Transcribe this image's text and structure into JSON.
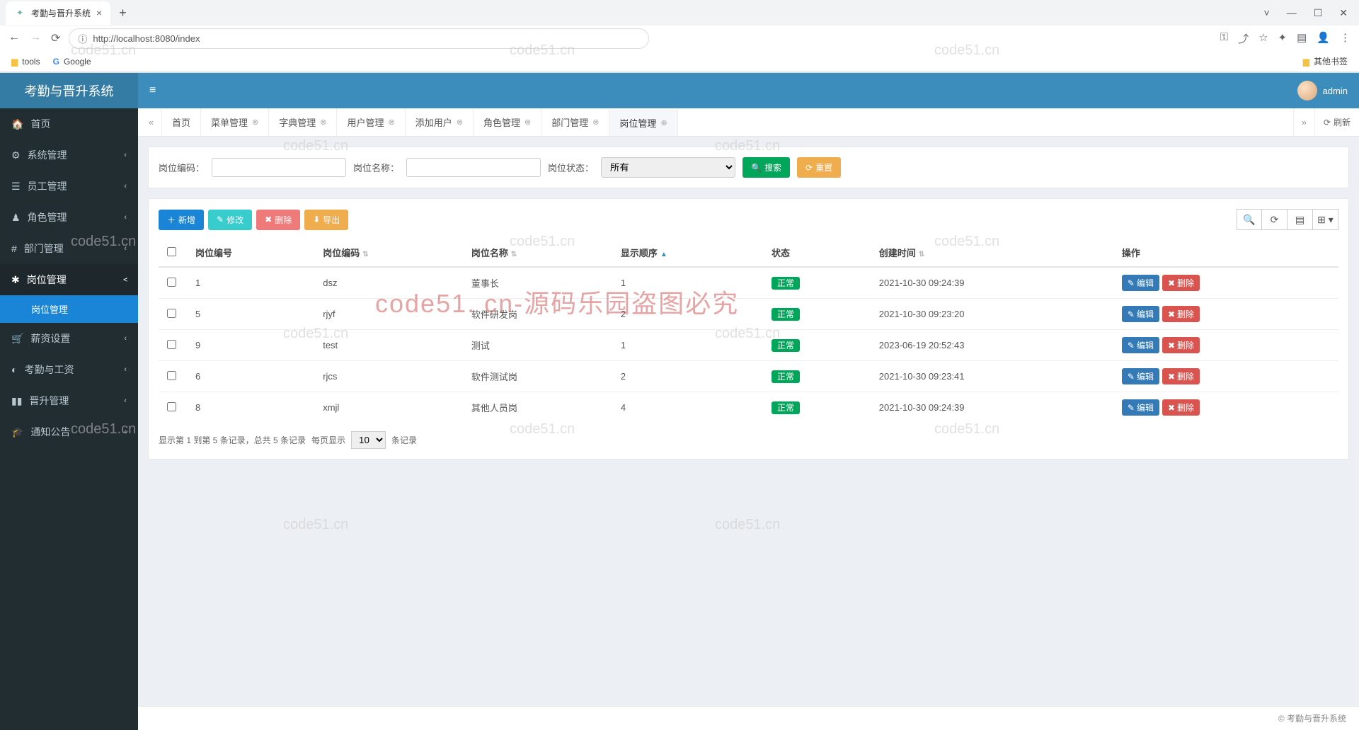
{
  "browser": {
    "tab_title": "考勤与晋升系统",
    "url": "http://localhost:8080/index",
    "bookmarks": {
      "tools": "tools",
      "google": "Google",
      "other": "其他书签"
    }
  },
  "brand": "考勤与晋升系统",
  "topbar": {
    "username": "admin"
  },
  "sidebar": {
    "home": "首页",
    "system": "系统管理",
    "employee": "员工管理",
    "role": "角色管理",
    "dept": "部门管理",
    "post": "岗位管理",
    "post_sub": "岗位管理",
    "salary": "薪资设置",
    "attend": "考勤与工资",
    "promo": "晋升管理",
    "notice": "通知公告"
  },
  "tabs": {
    "home": "首页",
    "menu": "菜单管理",
    "dict": "字典管理",
    "user": "用户管理",
    "adduser": "添加用户",
    "rolem": "角色管理",
    "deptm": "部门管理",
    "postm": "岗位管理",
    "refresh": "刷新"
  },
  "filter": {
    "code_label": "岗位编码：",
    "name_label": "岗位名称：",
    "status_label": "岗位状态：",
    "status_value": "所有",
    "search": "搜索",
    "reset": "重置"
  },
  "toolbar": {
    "add": "新增",
    "edit": "修改",
    "del": "删除",
    "export": "导出"
  },
  "table": {
    "cols": {
      "id": "岗位编号",
      "code": "岗位编码",
      "name": "岗位名称",
      "order": "显示顺序",
      "status": "状态",
      "created": "创建时间",
      "op": "操作"
    },
    "status_normal": "正常",
    "edit_label": "编辑",
    "del_label": "删除",
    "rows": [
      {
        "id": "1",
        "code": "dsz",
        "name": "董事长",
        "order": "1",
        "created": "2021-10-30 09:24:39"
      },
      {
        "id": "5",
        "code": "rjyf",
        "name": "软件研发岗",
        "order": "2",
        "created": "2021-10-30 09:23:20"
      },
      {
        "id": "9",
        "code": "test",
        "name": "测试",
        "order": "1",
        "created": "2023-06-19 20:52:43"
      },
      {
        "id": "6",
        "code": "rjcs",
        "name": "软件测试岗",
        "order": "2",
        "created": "2021-10-30 09:23:41"
      },
      {
        "id": "8",
        "code": "xmjl",
        "name": "其他人员岗",
        "order": "4",
        "created": "2021-10-30 09:24:39"
      }
    ]
  },
  "pager": {
    "summary": "显示第 1 到第 5 条记录，总共 5 条记录",
    "per_page_prefix": "每页显示",
    "per_page_value": "10",
    "per_page_suffix": "条记录"
  },
  "footer": "© 考勤与晋升系统",
  "watermark": {
    "text": "code51.cn",
    "big": "code51. cn-源码乐园盗图必究"
  }
}
